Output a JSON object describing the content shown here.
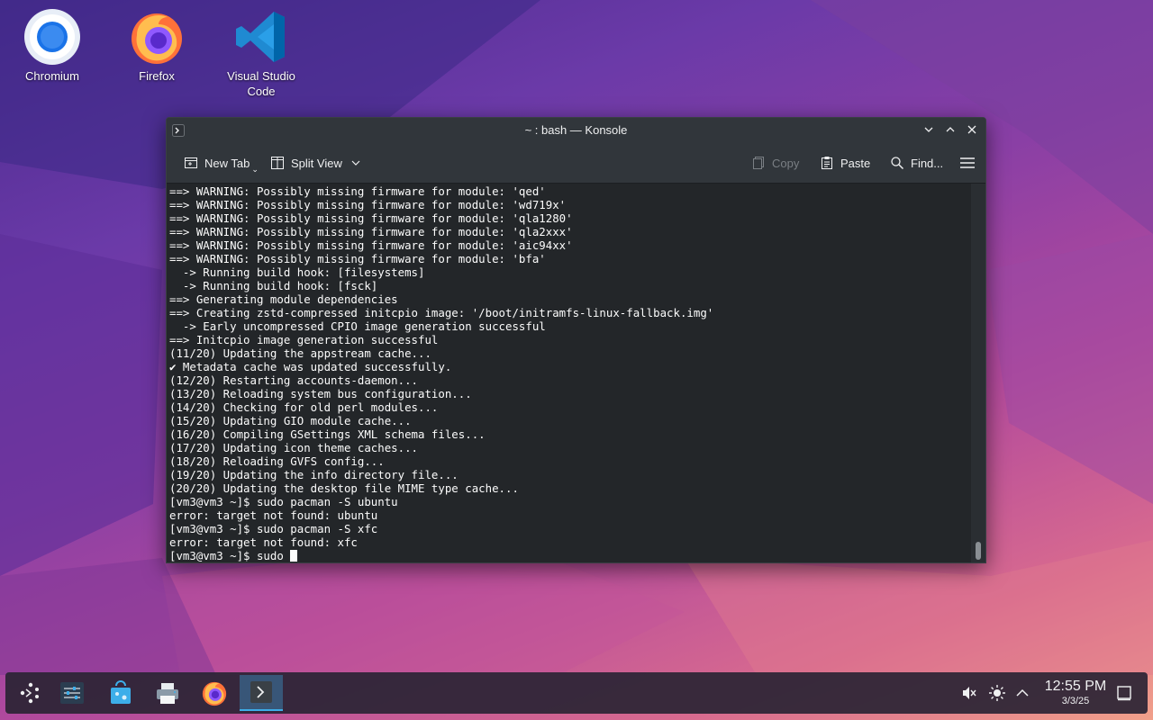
{
  "desktop": {
    "icons": [
      {
        "label": "Chromium"
      },
      {
        "label": "Firefox"
      },
      {
        "label": "Visual Studio Code"
      }
    ]
  },
  "window": {
    "title": "~ : bash — Konsole",
    "toolbar": {
      "new_tab": "New Tab",
      "split_view": "Split View",
      "copy": "Copy",
      "paste": "Paste",
      "find": "Find..."
    },
    "terminal_lines": [
      "==> WARNING: Possibly missing firmware for module: 'qed'",
      "==> WARNING: Possibly missing firmware for module: 'wd719x'",
      "==> WARNING: Possibly missing firmware for module: 'qla1280'",
      "==> WARNING: Possibly missing firmware for module: 'qla2xxx'",
      "==> WARNING: Possibly missing firmware for module: 'aic94xx'",
      "==> WARNING: Possibly missing firmware for module: 'bfa'",
      "  -> Running build hook: [filesystems]",
      "  -> Running build hook: [fsck]",
      "==> Generating module dependencies",
      "==> Creating zstd-compressed initcpio image: '/boot/initramfs-linux-fallback.img'",
      "  -> Early uncompressed CPIO image generation successful",
      "==> Initcpio image generation successful",
      "(11/20) Updating the appstream cache...",
      "✔ Metadata cache was updated successfully.",
      "(12/20) Restarting accounts-daemon...",
      "(13/20) Reloading system bus configuration...",
      "(14/20) Checking for old perl modules...",
      "(15/20) Updating GIO module cache...",
      "(16/20) Compiling GSettings XML schema files...",
      "(17/20) Updating icon theme caches...",
      "(18/20) Reloading GVFS config...",
      "(19/20) Updating the info directory file...",
      "(20/20) Updating the desktop file MIME type cache...",
      "[vm3@vm3 ~]$ sudo pacman -S ubuntu",
      "error: target not found: ubuntu",
      "[vm3@vm3 ~]$ sudo pacman -S xfc",
      "error: target not found: xfc"
    ],
    "prompt": "[vm3@vm3 ~]$ sudo "
  },
  "taskbar": {
    "time": "12:55 PM",
    "date": "3/3/25",
    "pinned": [
      "application-launcher-icon",
      "system-settings-icon",
      "discover-icon",
      "printer-icon",
      "firefox-icon",
      "konsole-icon"
    ]
  },
  "colors": {
    "terminal_bg": "#232629",
    "terminal_fg": "#fcfcfc",
    "accent": "#3daee9"
  }
}
